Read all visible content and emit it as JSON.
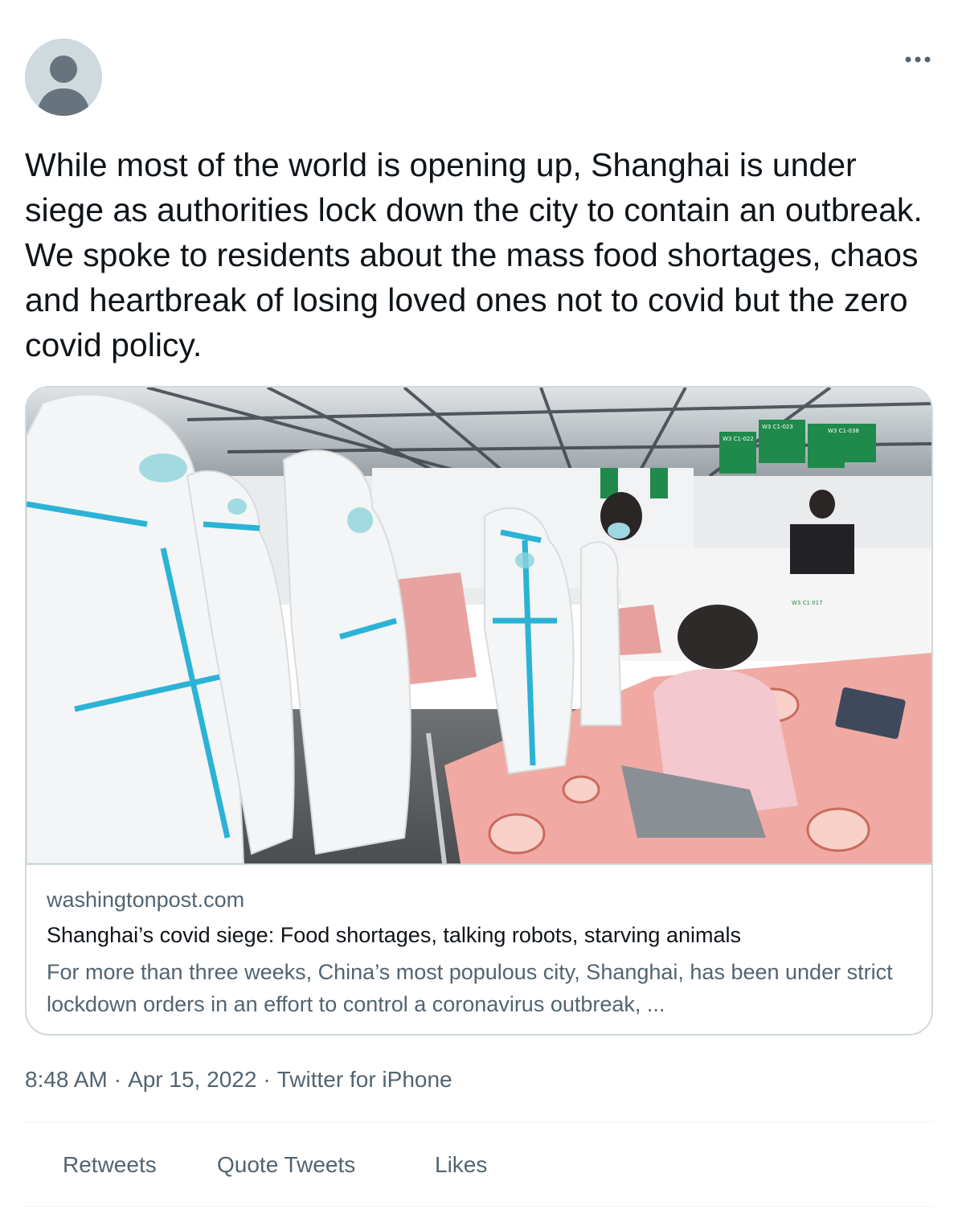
{
  "tweet": {
    "text": "While most of the world is opening up, Shanghai is under siege as authorities lock down the city to contain an outbreak. We spoke to residents about the mass food shortages, chaos and heartbreak of losing loved ones not to covid but the zero covid policy.",
    "more_icon": "more-horizontal-icon",
    "avatar_icon": "default-user-avatar-icon"
  },
  "card": {
    "image_icon": "photo-medical-staff-in-quarantine-hall",
    "image_signs": [
      "W3 C1-022",
      "W3 C1-023",
      "W3 C1-038",
      "W3 C1 017"
    ],
    "domain": "washingtonpost.com",
    "title": "Shanghai’s covid siege: Food shortages, talking robots, starving animals",
    "description": "For more than three weeks, China’s most populous city, Shanghai, has been under strict lockdown orders in an effort to control a coronavirus outbreak, ..."
  },
  "meta": {
    "time": "8:48 AM",
    "separator": "·",
    "date": "Apr 15, 2022",
    "source": "Twitter for iPhone"
  },
  "stats": {
    "retweets_label": "Retweets",
    "quote_tweets_label": "Quote Tweets",
    "likes_label": "Likes"
  },
  "colors": {
    "text_primary": "#0f1419",
    "text_secondary": "#536471",
    "border": "#cfd9de",
    "divider": "#eff3f4"
  }
}
